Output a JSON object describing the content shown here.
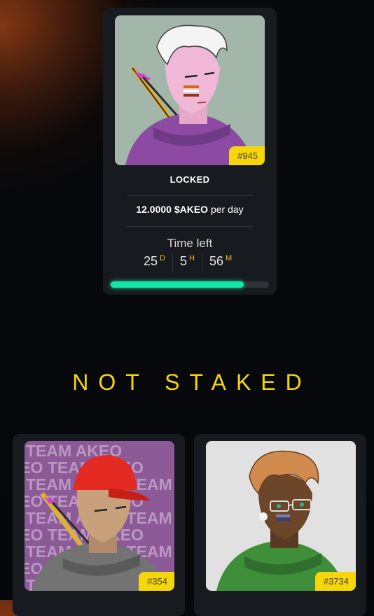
{
  "staked_card": {
    "token_id": "#945",
    "status": "LOCKED",
    "reward_amount": "12.0000 $AKEO",
    "reward_period": " per day",
    "time_left_label": "Time left",
    "countdown": [
      {
        "value": "25",
        "unit": "D"
      },
      {
        "value": "5",
        "unit": "H"
      },
      {
        "value": "56",
        "unit": "M"
      }
    ],
    "progress": 0.84
  },
  "not_staked": {
    "title": "NOT STAKED",
    "cards": [
      {
        "token_id": "#354",
        "background_text": "TEAM AKEO"
      },
      {
        "token_id": "#3734"
      }
    ]
  },
  "colors": {
    "accent_yellow": "#f5d60b",
    "progress_green": "#15e6a6",
    "card_bg": "#171b1f"
  }
}
